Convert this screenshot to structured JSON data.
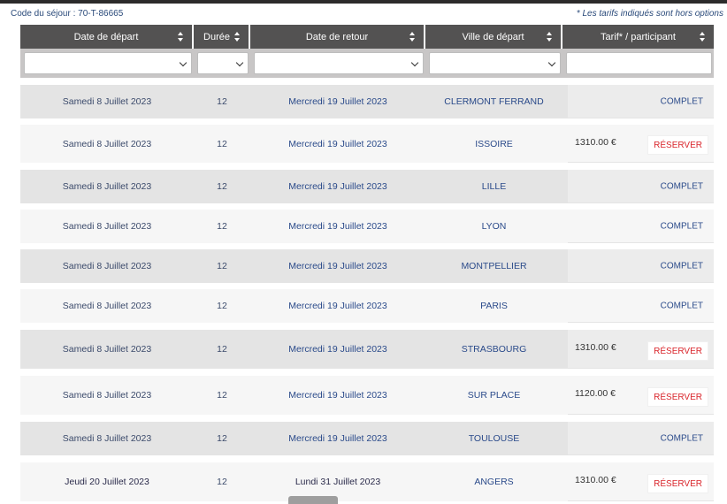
{
  "code_sejour": "Code du séjour : 70-T-86665",
  "note": "* Les tarifs indiqués sont hors options",
  "headers": {
    "depart": "Date de départ",
    "duree": "Durée",
    "retour": "Date de retour",
    "ville": "Ville de départ",
    "tarif": "Tarif* / participant"
  },
  "filters": {
    "depart": "",
    "duree": "",
    "retour": "",
    "ville": "",
    "tarif": ""
  },
  "rows": [
    {
      "depart": "Samedi 8 Juillet 2023",
      "duree": "12",
      "retour": "Mercredi 19 Juillet 2023",
      "ville": "CLERMONT FERRAND",
      "price": "",
      "status": "COMPLET"
    },
    {
      "depart": "Samedi 8 Juillet 2023",
      "duree": "12",
      "retour": "Mercredi 19 Juillet 2023",
      "ville": "ISSOIRE",
      "price": "1310.00 €",
      "status": "RÉSERVER"
    },
    {
      "depart": "Samedi 8 Juillet 2023",
      "duree": "12",
      "retour": "Mercredi 19 Juillet 2023",
      "ville": "LILLE",
      "price": "",
      "status": "COMPLET"
    },
    {
      "depart": "Samedi 8 Juillet 2023",
      "duree": "12",
      "retour": "Mercredi 19 Juillet 2023",
      "ville": "LYON",
      "price": "",
      "status": "COMPLET"
    },
    {
      "depart": "Samedi 8 Juillet 2023",
      "duree": "12",
      "retour": "Mercredi 19 Juillet 2023",
      "ville": "MONTPELLIER",
      "price": "",
      "status": "COMPLET"
    },
    {
      "depart": "Samedi 8 Juillet 2023",
      "duree": "12",
      "retour": "Mercredi 19 Juillet 2023",
      "ville": "PARIS",
      "price": "",
      "status": "COMPLET"
    },
    {
      "depart": "Samedi 8 Juillet 2023",
      "duree": "12",
      "retour": "Mercredi 19 Juillet 2023",
      "ville": "STRASBOURG",
      "price": "1310.00 €",
      "status": "RÉSERVER"
    },
    {
      "depart": "Samedi 8 Juillet 2023",
      "duree": "12",
      "retour": "Mercredi 19 Juillet 2023",
      "ville": "SUR PLACE",
      "price": "1120.00 €",
      "status": "RÉSERVER"
    },
    {
      "depart": "Samedi 8 Juillet 2023",
      "duree": "12",
      "retour": "Mercredi 19 Juillet 2023",
      "ville": "TOULOUSE",
      "price": "",
      "status": "COMPLET"
    },
    {
      "depart": "Jeudi 20 Juillet 2023",
      "duree": "12",
      "retour": "Lundi 31 Juillet 2023",
      "ville": "ANGERS",
      "price": "1310.00 €",
      "status": "RÉSERVER"
    }
  ],
  "colors": {
    "header_bg": "#535252",
    "filter_bg": "#c8c6c6",
    "row_dark": "#e4e4e4",
    "row_light": "#f6f6f6",
    "reserve_red": "#d9242a",
    "link_blue": "#2a4a8a"
  }
}
